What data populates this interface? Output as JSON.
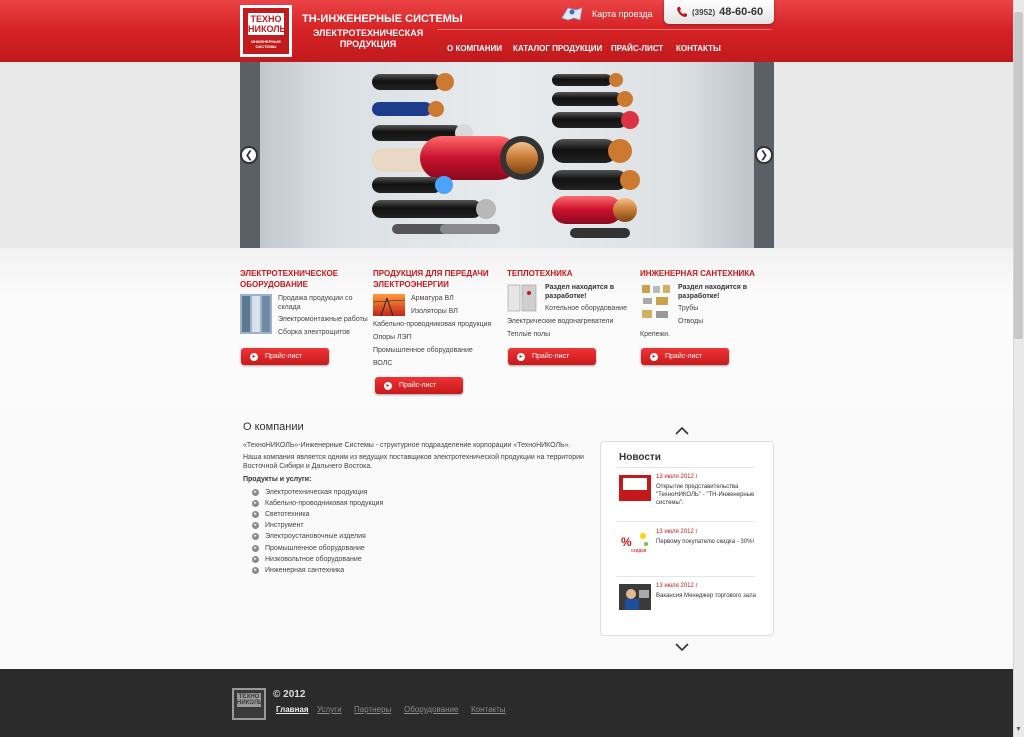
{
  "header": {
    "logo_text": "ТЕХНО НИКОЛЬ",
    "logo_sub": "ИНЖЕНЕРНЫЕ СИСТЕМЫ",
    "brand_title": "ТН-ИНЖЕНЕРНЫЕ СИСТЕМЫ",
    "brand_subtitle": "ЭЛЕКТРОТЕХНИЧЕСКАЯ ПРОДУКЦИЯ",
    "map_link": "Карта проезда",
    "phone_code": "(3952)",
    "phone_number": "48-60-60",
    "nav": [
      "О КОМПАНИИ",
      "КАТАЛОГ ПРОДУКЦИИ",
      "ПРАЙС-ЛИСТ",
      "КОНТАКТЫ"
    ]
  },
  "slider": {
    "prev_icon": "chevron-left-icon",
    "next_icon": "chevron-right-icon"
  },
  "categories": [
    {
      "title": "ЭЛЕКТРОТЕХНИЧЕСКОЕ ОБОРУДОВАНИЕ",
      "items": [
        "Продажа продукции со склада",
        "Электромонтажные работы",
        "Сборка электрощитов"
      ],
      "button": "Прайс-лист"
    },
    {
      "title": "ПРОДУКЦИЯ ДЛЯ ПЕРЕДАЧИ ЭЛЕКТРОЭНЕРГИИ",
      "items": [
        "Арматура ВЛ",
        "Изоляторы ВЛ",
        "Кабельно-проводниковая продукция",
        "Опоры ЛЭП",
        "Промышленное оборудование",
        "ВОЛС"
      ],
      "button": "Прайс-лист"
    },
    {
      "title": "ТЕПЛОТЕХНИКА",
      "note": "Раздел находится в разработке!",
      "items": [
        "Котельное оборудование",
        "Электрические водонагреватели",
        "Теплые полы"
      ],
      "button": "Прайс-лист"
    },
    {
      "title": "ИНЖЕНЕРНАЯ САНТЕХНИКА",
      "note": "Раздел находится в разработке!",
      "items": [
        "Трубы",
        "Отводы",
        "Крепежи."
      ],
      "button": "Прайс-лист"
    }
  ],
  "about": {
    "title": "О компании",
    "para1": "«ТехноНИКОЛЬ»-Инженерные Системы - структурное подразделение корпорации «ТехноНИКОЛЬ».",
    "para2": "Наша компания является одним из ведущих поставщиков электротехнической продукции на территории Восточной Сибири и Дальнего Востока.",
    "services_label": "Продукты и услуги:",
    "services": [
      "Электротехническая продукция",
      "Кабельно-проводниковая продукция",
      "Светотехника",
      "Инструмент",
      "Электроустановочные изделия",
      "Промышленное оборудование",
      "Низковольтное оборудование",
      "Инженерная сантехника"
    ]
  },
  "news": {
    "title": "Новости",
    "items": [
      {
        "date": "13 июля 2012 г",
        "text": "Открытие представительства \"ТехноНИКОЛЬ\" - \"ТН-Инженерные системы\"."
      },
      {
        "date": "13 июля 2012 г",
        "text": "Первому покупателю скидка - 30%!"
      },
      {
        "date": "13 июля 2012 г",
        "text": "Вакансия Менеджер торгового зала"
      }
    ],
    "discount_label": "скидки"
  },
  "footer": {
    "copyright": "© 2012",
    "links": [
      "Главная",
      "Услуги",
      "Партнеры",
      "Оборудование",
      "Контакты"
    ]
  },
  "colors": {
    "brand_red": "#c5181b",
    "footer_bg": "#2b2b2b"
  }
}
